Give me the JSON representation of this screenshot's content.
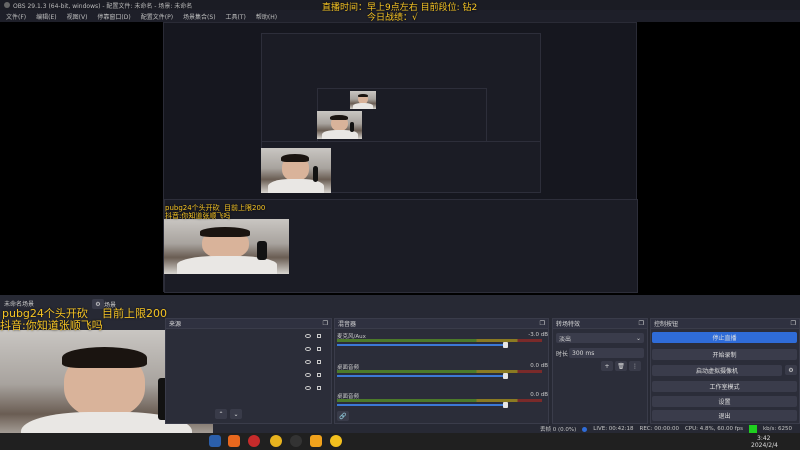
{
  "window": {
    "title": "OBS 29.1.3 (64-bit, windows) - 配置文件: 未命名 - 场景: 未命名"
  },
  "menu": [
    "文件(F)",
    "编辑(E)",
    "视图(V)",
    "停靠窗口(D)",
    "配置文件(P)",
    "场景集合(S)",
    "工具(T)",
    "帮助(H)"
  ],
  "overlay": {
    "line1": "直播时间：早上9点左右  目前段位: 钻2",
    "line2": "今日战绩：√",
    "line3": "pubg24个头开砍",
    "line4": "目前上限200",
    "line5": "抖音:你知道张顺飞吗"
  },
  "scene_label": "未命名场景",
  "scene_tab": "场景",
  "docks": {
    "sources": {
      "title": "来源"
    },
    "mixer": {
      "title": "混音器",
      "channels": [
        {
          "name": "麦克风/Aux",
          "db": "-3.0 dB"
        },
        {
          "name": "桌面音频",
          "db": "0.0 dB"
        },
        {
          "name": "桌面音频",
          "db": "0.0 dB"
        }
      ]
    },
    "transitions": {
      "title": "转场特效",
      "type": "淡出",
      "duration_label": "时长",
      "duration": "300 ms"
    },
    "controls": {
      "title": "控制按钮",
      "buttons": [
        "停止直播",
        "开始录制",
        "启动虚拟摄像机",
        "工作室模式",
        "设置",
        "退出"
      ]
    }
  },
  "status": {
    "dropped": "丢帧 0 (0.0%)",
    "live": "LIVE: 00:42:18",
    "rec": "REC: 00:00:00",
    "cpu": "CPU: 4.8%, 60.00 fps",
    "kbps": "kb/s: 6250"
  },
  "taskbar": {
    "time": "3:42",
    "date": "2024/2/4"
  },
  "colors": {
    "accent": "#2f6cd8",
    "overlay": "#f7c524",
    "live": "#1fd01f"
  }
}
